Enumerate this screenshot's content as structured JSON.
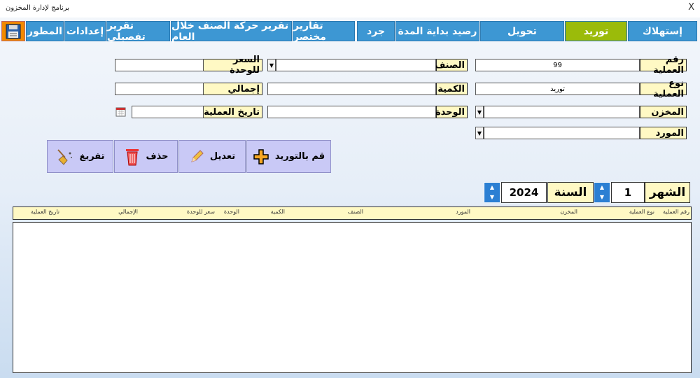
{
  "window": {
    "title": "برنامج لإدارة المخزون",
    "close": "X"
  },
  "tabs": [
    "المطور",
    "إعدادات",
    "تقرير تفصيلي",
    "تقرير حركة الصنف خلال العام",
    "تقارير مختصر",
    "جرد",
    "رصيد بداية المدة",
    "تحويل",
    "توريد",
    "إستهلاك"
  ],
  "colors": {
    "tab": "#3d97d3",
    "active_tab": "#9bbb0a",
    "label_bg": "#fff9c4",
    "button_bg": "#c9c9f6"
  },
  "form": {
    "op_number_label": "رقم العملية",
    "op_number": "99",
    "op_type_label": "نوع العملية",
    "op_type": "توريد",
    "store_label": "المخزن",
    "supplier_label": "المورد",
    "item_label": "الصنف",
    "qty_label": "الكمية",
    "unit_label": "الوحدة",
    "price_label": "السعر للوحدة",
    "total_label": "إجمالي",
    "date_label": "تاريخ العملية"
  },
  "buttons": {
    "supply": "قم بالتوريد",
    "edit": "تعديل",
    "delete": "حذف",
    "clear": "تفريغ"
  },
  "filter": {
    "month_label": "الشهر",
    "month": "1",
    "year_label": "السنة",
    "year": "2024"
  },
  "table": {
    "columns": [
      "رقم العملية",
      "نوع العملية",
      "المخزن",
      "المورد",
      "الصنف",
      "الكمية",
      "الوحدة",
      "سعر للوحدة",
      "الإجمالي",
      "تاريخ العملية"
    ]
  }
}
